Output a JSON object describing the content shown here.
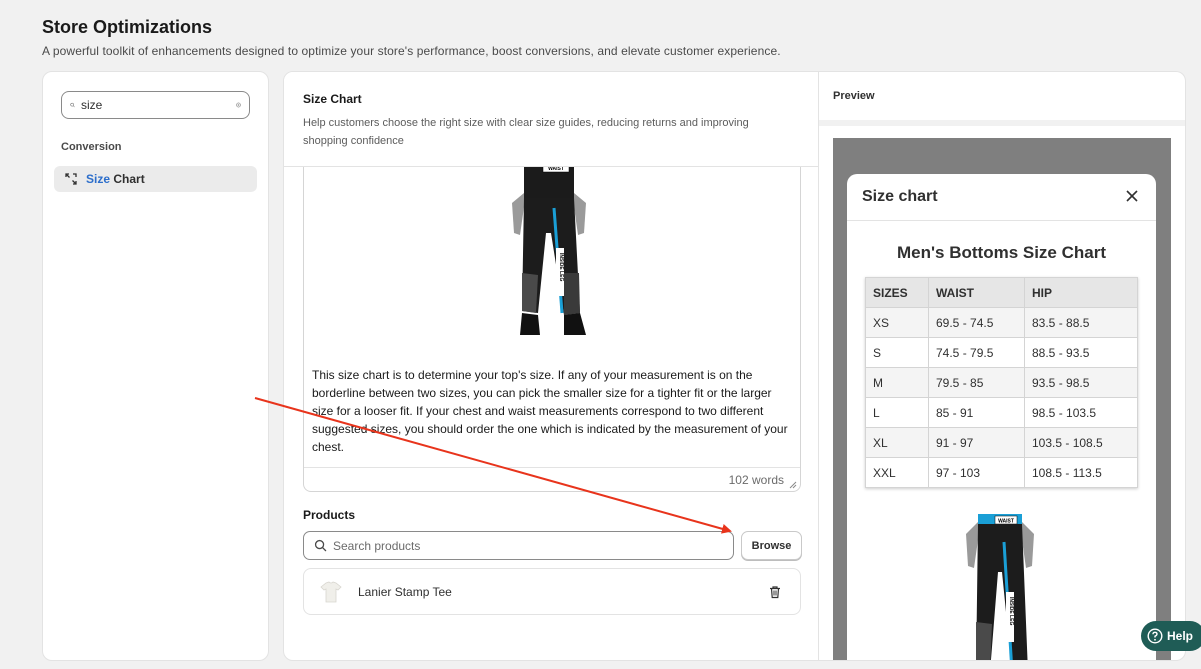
{
  "page": {
    "title": "Store Optimizations",
    "subtitle": "A powerful toolkit of enhancements designed to optimize your store's performance, boost conversions, and elevate customer experience."
  },
  "sidebar": {
    "search_value": "size",
    "section": "Conversion",
    "items": [
      {
        "label_highlight": "Size",
        "label_rest": " Chart",
        "icon": "resize-icon"
      }
    ]
  },
  "main": {
    "title": "Size Chart",
    "description": "Help customers choose the right size with clear size guides, reducing returns and improving shopping confidence",
    "editor": {
      "image_labels": {
        "waist": "WAIST",
        "inside_leg": "INSIDE LEG"
      },
      "text": "This size chart is to determine your top's size. If any of your measurement is on the borderline between two sizes, you can pick the smaller size for a tighter fit or the larger size for a looser fit. If your chest and waist measurements correspond to two different suggested sizes, you should order the one which is indicated by the measurement of your chest.",
      "word_count": "102 words"
    },
    "products": {
      "label": "Products",
      "search_placeholder": "Search products",
      "browse_label": "Browse",
      "items": [
        {
          "name": "Lanier Stamp Tee"
        }
      ]
    }
  },
  "preview": {
    "label": "Preview",
    "modal": {
      "title": "Size chart",
      "chart_title": "Men's Bottoms Size Chart",
      "headers": [
        "SIZES",
        "WAIST",
        "HIP"
      ],
      "rows": [
        [
          "XS",
          "69.5 - 74.5",
          "83.5 - 88.5"
        ],
        [
          "S",
          "74.5 - 79.5",
          "88.5 - 93.5"
        ],
        [
          "M",
          "79.5 - 85",
          "93.5 - 98.5"
        ],
        [
          "L",
          "85 - 91",
          "98.5 - 103.5"
        ],
        [
          "XL",
          "91 - 97",
          "103.5 - 108.5"
        ],
        [
          "XXL",
          "97 - 103",
          "108.5 - 113.5"
        ]
      ],
      "image_labels": {
        "waist": "WAIST",
        "inside_leg": "INSIDE LEG"
      }
    }
  },
  "help": {
    "label": "Help"
  },
  "colors": {
    "accent": "#2c6ecb",
    "help_bg": "#1f5c56",
    "annotation": "#e8341c"
  }
}
